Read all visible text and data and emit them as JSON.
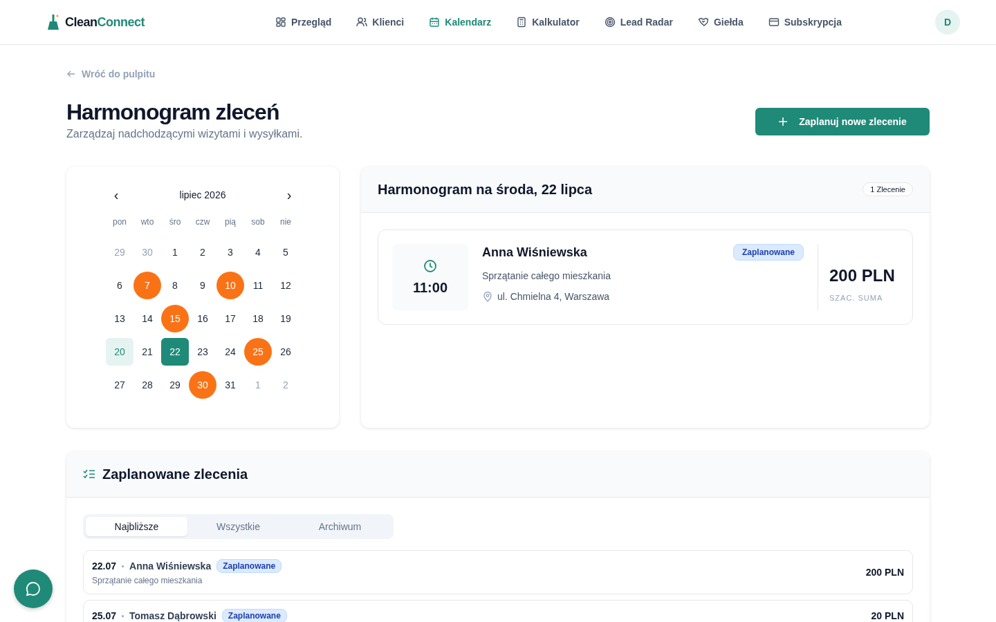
{
  "brand": {
    "part1": "Clean",
    "part2": "Connect"
  },
  "nav": [
    {
      "label": "Przegląd",
      "selected": false
    },
    {
      "label": "Klienci",
      "selected": false
    },
    {
      "label": "Kalendarz",
      "selected": true
    },
    {
      "label": "Kalkulator",
      "selected": false
    },
    {
      "label": "Lead Radar",
      "selected": false
    },
    {
      "label": "Giełda",
      "selected": false
    },
    {
      "label": "Subskrypcja",
      "selected": false
    }
  ],
  "avatar": "D",
  "back_link": "Wróć do pulpitu",
  "title": "Harmonogram zleceń",
  "subtitle": "Zarządzaj nadchodzącymi wizytami i wysyłkami.",
  "new_button": "Zaplanuj nowe zlecenie",
  "calendar": {
    "month": "lipiec 2026",
    "prev": "‹",
    "next": "›",
    "weekdays": [
      "pon",
      "wto",
      "śro",
      "czw",
      "pią",
      "sob",
      "nie"
    ],
    "days": [
      {
        "label": "29",
        "kind": "outside",
        "selected": false
      },
      {
        "label": "30",
        "kind": "outside",
        "selected": false
      },
      {
        "label": "1",
        "kind": "normal",
        "selected": false
      },
      {
        "label": "2",
        "kind": "normal",
        "selected": false
      },
      {
        "label": "3",
        "kind": "normal",
        "selected": false
      },
      {
        "label": "4",
        "kind": "normal",
        "selected": false
      },
      {
        "label": "5",
        "kind": "normal",
        "selected": false
      },
      {
        "label": "6",
        "kind": "normal",
        "selected": false
      },
      {
        "label": "7",
        "kind": "event",
        "selected": false
      },
      {
        "label": "8",
        "kind": "normal",
        "selected": false
      },
      {
        "label": "9",
        "kind": "normal",
        "selected": false
      },
      {
        "label": "10",
        "kind": "event",
        "selected": false
      },
      {
        "label": "11",
        "kind": "normal",
        "selected": false
      },
      {
        "label": "12",
        "kind": "normal",
        "selected": false
      },
      {
        "label": "13",
        "kind": "normal",
        "selected": false
      },
      {
        "label": "14",
        "kind": "normal",
        "selected": false
      },
      {
        "label": "15",
        "kind": "event",
        "selected": false
      },
      {
        "label": "16",
        "kind": "normal",
        "selected": false
      },
      {
        "label": "17",
        "kind": "normal",
        "selected": false
      },
      {
        "label": "18",
        "kind": "normal",
        "selected": false
      },
      {
        "label": "19",
        "kind": "normal",
        "selected": false
      },
      {
        "label": "20",
        "kind": "today",
        "selected": false
      },
      {
        "label": "21",
        "kind": "normal",
        "selected": false
      },
      {
        "label": "22",
        "kind": "normal",
        "selected": true
      },
      {
        "label": "23",
        "kind": "normal",
        "selected": false
      },
      {
        "label": "24",
        "kind": "normal",
        "selected": false
      },
      {
        "label": "25",
        "kind": "event",
        "selected": false
      },
      {
        "label": "26",
        "kind": "normal",
        "selected": false
      },
      {
        "label": "27",
        "kind": "normal",
        "selected": false
      },
      {
        "label": "28",
        "kind": "normal",
        "selected": false
      },
      {
        "label": "29",
        "kind": "normal",
        "selected": false
      },
      {
        "label": "30",
        "kind": "event",
        "selected": false
      },
      {
        "label": "31",
        "kind": "normal",
        "selected": false
      },
      {
        "label": "1",
        "kind": "outside",
        "selected": false
      },
      {
        "label": "2",
        "kind": "outside",
        "selected": false
      }
    ]
  },
  "day_schedule": {
    "title": "Harmonogram na środa, 22 lipca",
    "count": "1 Zlecenie",
    "jobs": [
      {
        "time": "11:00",
        "client": "Anna Wiśniewska",
        "status": "Zaplanowane",
        "service": "Sprzątanie całego mieszkania",
        "address": "ul. Chmielna 4, Warszawa",
        "amount": "200 PLN",
        "amount_label": "SZAC. SUMA"
      }
    ]
  },
  "planned": {
    "title": "Zaplanowane zlecenia",
    "tabs": [
      {
        "label": "Najbliższe",
        "selected": true
      },
      {
        "label": "Wszystkie",
        "selected": false
      },
      {
        "label": "Archiwum",
        "selected": false
      }
    ],
    "rows": [
      {
        "date": "22.07",
        "client": "Anna Wiśniewska",
        "status": "Zaplanowane",
        "service": "Sprzątanie całego mieszkania",
        "amount": "200 PLN"
      },
      {
        "date": "25.07",
        "client": "Tomasz Dąbrowski",
        "status": "Zaplanowane",
        "amount": "20 PLN"
      }
    ]
  }
}
